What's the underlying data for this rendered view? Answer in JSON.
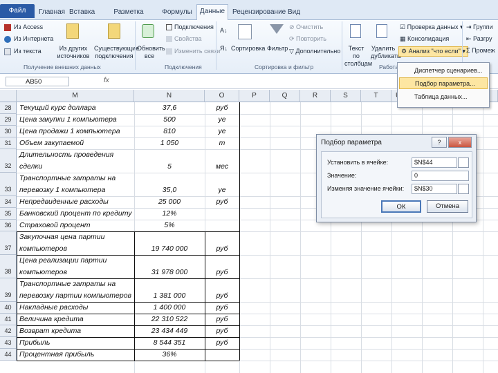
{
  "tabs": [
    "Файл",
    "Главная",
    "Вставка",
    "Разметка страницы",
    "Формулы",
    "Данные",
    "Рецензирование",
    "Вид"
  ],
  "ribbon": {
    "ext": {
      "access": "Из Access",
      "web": "Из Интернета",
      "text": "Из текста",
      "other": "Из других источников",
      "existing": "Существующие подключения",
      "label": "Получение внешних данных"
    },
    "conn": {
      "refresh": "Обновить все",
      "connections": "Подключения",
      "properties": "Свойства",
      "links": "Изменить связи",
      "label": "Подключения"
    },
    "sort": {
      "sort": "Сортировка",
      "filter": "Фильтр",
      "clear": "Очистить",
      "reapply": "Повторить",
      "advanced": "Дополнительно",
      "label": "Сортировка и фильтр"
    },
    "tools": {
      "text_to_cols": "Текст по столбцам",
      "remove_dup": "Удалить дубликаты",
      "validation": "Проверка данных",
      "consolidate": "Консолидация",
      "whatif": "Анализ \"что если\"",
      "label": "Работа с"
    },
    "outline": {
      "group": "Группи",
      "ungroup": "Разгру",
      "subtotal": "Промеж"
    }
  },
  "dropdown": [
    "Диспетчер сценариев...",
    "Подбор параметра...",
    "Таблица данных..."
  ],
  "namebox": "AB50",
  "columns": [
    "M",
    "N",
    "O",
    "P",
    "Q",
    "R",
    "S",
    "T",
    "U"
  ],
  "rows": [
    {
      "n": "28",
      "label": [
        "Текущий курс доллара"
      ],
      "val": "37,6",
      "unit": "руб"
    },
    {
      "n": "29",
      "label": [
        "Цена закупки 1 компьютера"
      ],
      "val": "500",
      "unit": "уе"
    },
    {
      "n": "30",
      "label": [
        "Цена продажи 1 компьютера"
      ],
      "val": "810",
      "unit": "уе"
    },
    {
      "n": "31",
      "label": [
        "Объем закупаемой"
      ],
      "val": "1 050",
      "unit": "т"
    },
    {
      "n": "32",
      "label": [
        "Длительность проведения",
        "сделки"
      ],
      "val": "5",
      "unit": "мес"
    },
    {
      "n": "33",
      "label": [
        "Транспортные затраты на",
        "перевозку 1 компьютера"
      ],
      "val": "35,0",
      "unit": "уе"
    },
    {
      "n": "34",
      "label": [
        "Непредвиденные расходы"
      ],
      "val": "25 000",
      "unit": "руб"
    },
    {
      "n": "35",
      "label": [
        "Банковский процент по кредиту"
      ],
      "val": "12%",
      "unit": ""
    },
    {
      "n": "36",
      "label": [
        "Страховой процент"
      ],
      "val": "5%",
      "unit": ""
    },
    {
      "n": "37",
      "label": [
        "Закупочная цена партии",
        "компьютеров"
      ],
      "val": "19 740 000",
      "unit": "руб"
    },
    {
      "n": "38",
      "label": [
        "Цена реализации партии",
        "компьютеров"
      ],
      "val": "31 978 000",
      "unit": "руб"
    },
    {
      "n": "39",
      "label": [
        "Транспортные затраты на",
        "перевозку партии компьютеров"
      ],
      "val": "1 381 000",
      "unit": "руб"
    },
    {
      "n": "40",
      "label": [
        "Накладные расходы"
      ],
      "val": "1 400 000",
      "unit": "руб"
    },
    {
      "n": "41",
      "label": [
        "Величина кредита"
      ],
      "val": "22 310 522",
      "unit": "руб"
    },
    {
      "n": "42",
      "label": [
        "Возврат кредита"
      ],
      "val": "23 434 449",
      "unit": "руб"
    },
    {
      "n": "43",
      "label": [
        "Прибыль"
      ],
      "val": "8 544 351",
      "unit": "руб"
    },
    {
      "n": "44",
      "label": [
        "Процентная прибыль"
      ],
      "val": "36%",
      "unit": ""
    }
  ],
  "dialog": {
    "title": "Подбор параметра",
    "set_cell_label": "Установить в ячейке:",
    "set_cell_value": "$N$44",
    "value_label": "Значение:",
    "value_value": "0",
    "changing_label": "Изменяя значение ячейки:",
    "changing_value": "$N$30",
    "ok": "ОК",
    "cancel": "Отмена",
    "help": "?",
    "close": "x"
  }
}
